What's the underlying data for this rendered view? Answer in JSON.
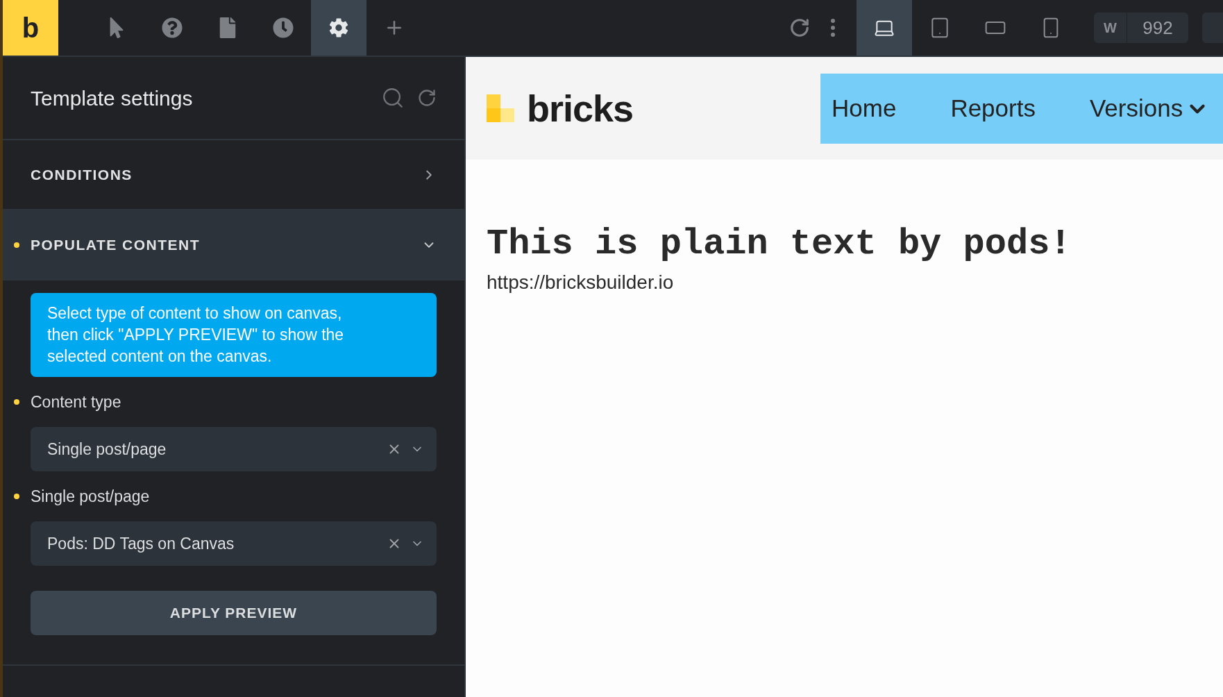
{
  "toolbar": {
    "logo": "b",
    "tools": [
      {
        "kind": "pointer",
        "selected": false
      },
      {
        "kind": "help",
        "selected": false
      },
      {
        "kind": "page",
        "selected": false
      },
      {
        "kind": "history",
        "selected": false
      },
      {
        "kind": "settings",
        "selected": true
      },
      {
        "kind": "add",
        "selected": false
      }
    ],
    "actions": [
      {
        "kind": "reload"
      },
      {
        "kind": "more"
      }
    ],
    "devices": [
      {
        "kind": "laptop",
        "selected": true
      },
      {
        "kind": "tablet",
        "selected": false
      },
      {
        "kind": "landscape",
        "selected": false
      },
      {
        "kind": "phone",
        "selected": false
      }
    ],
    "width": {
      "label": "W",
      "value": "992"
    }
  },
  "sidebar": {
    "title": "Template settings",
    "sections": [
      {
        "label": "CONDITIONS",
        "expanded": false,
        "modified": false
      },
      {
        "label": "POPULATE CONTENT",
        "expanded": true,
        "modified": true
      }
    ],
    "info": "Select type of content to show on canvas, then click \"APPLY PREVIEW\" to show the selected content on the canvas.",
    "fields": [
      {
        "label": "Content type",
        "value": "Single post/page",
        "modified": true
      },
      {
        "label": "Single post/page",
        "value": "Pods: DD Tags on Canvas",
        "modified": true
      }
    ],
    "button": "APPLY PREVIEW"
  },
  "canvas": {
    "logo": "bricks",
    "nav": [
      {
        "label": "Home",
        "dropdown": false
      },
      {
        "label": "Reports",
        "dropdown": false
      },
      {
        "label": "Versions",
        "dropdown": true
      }
    ],
    "heading": "This is plain text by pods!",
    "url": "https://bricksbuilder.io"
  }
}
